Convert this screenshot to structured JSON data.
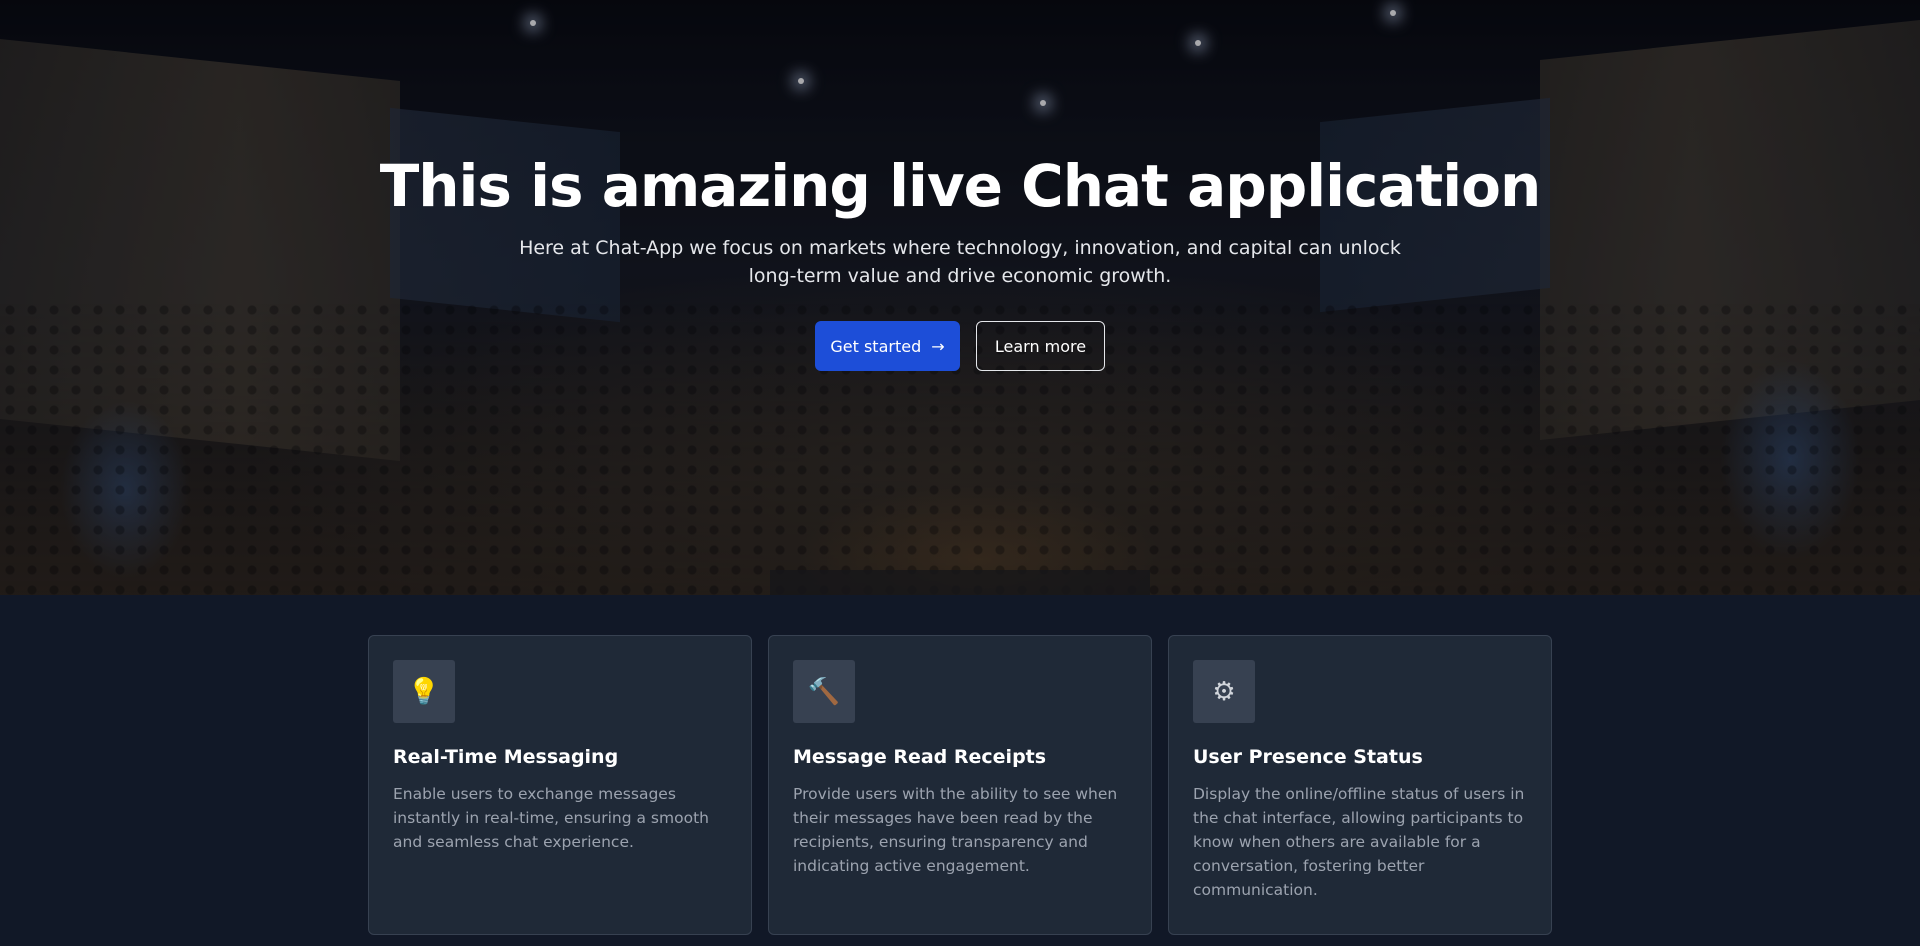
{
  "hero": {
    "title": "This is amazing live Chat application",
    "subtitle_line1": "Here at Chat-App we focus on markets where technology, innovation, and capital can unlock",
    "subtitle_line2": "long-term value and drive economic growth.",
    "primary_button": "Get started",
    "primary_arrow": "→",
    "secondary_button": "Learn more"
  },
  "features": [
    {
      "icon": "lightbulb-icon",
      "glyph": "💡",
      "title": "Real-Time Messaging",
      "text": "Enable users to exchange messages instantly in real-time, ensuring a smooth and seamless chat experience."
    },
    {
      "icon": "hammer-icon",
      "glyph": "🔨",
      "title": "Message Read Receipts",
      "text": "Provide users with the ability to see when their messages have been read by the recipients, ensuring transparency and indicating active engagement."
    },
    {
      "icon": "gear-icon",
      "glyph": "⚙",
      "title": "User Presence Status",
      "text": "Display the online/offline status of users in the chat interface, allowing participants to know when others are available for a conversation, fostering better communication."
    }
  ],
  "colors": {
    "primary": "#1d4ed8",
    "background": "#111827",
    "card": "#1f2937",
    "card_border": "#374151",
    "muted_text": "#9ca3af"
  }
}
